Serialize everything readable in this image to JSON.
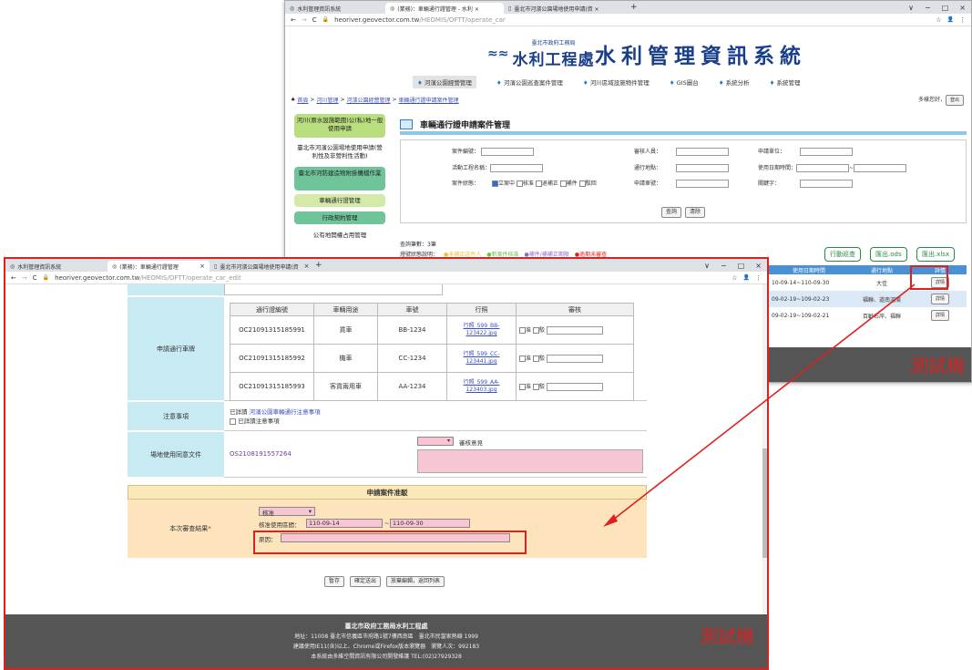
{
  "back_window": {
    "tabs": [
      {
        "label": "水利管理資訊系統"
      },
      {
        "label": "(業務)：車輛通行證管理 - 水利 ×"
      },
      {
        "label": "臺北市河濱公園場地使用申請(資 ×"
      }
    ],
    "new_tab": "+",
    "controls": {
      "min": "−",
      "max": "□",
      "close": "×",
      "chevron": "∨"
    },
    "nav": {
      "back": "←",
      "forward": "→",
      "reload": "C",
      "lock": "🔒"
    },
    "url_host": "heoriver.geovector.com.tw",
    "url_path": "/HEOMIS/OFTT/operate_car",
    "bar_icons": {
      "star": "☆",
      "profile": "👤",
      "menu": "⋮"
    },
    "banner": {
      "agency_small": "臺北市政府工務局",
      "agency": "水利工程處",
      "system_title": "水利管理資訊系統"
    },
    "topnav": [
      "河濱公園經營管理",
      "河濱公園巡查案件管理",
      "河川區域設施物件管理",
      "GIS圖台",
      "系統分析",
      "系統管理"
    ],
    "breadcrumb": [
      "首頁",
      "河川管理",
      "河濱公園經營管理",
      "車輛通行證申請案件管理"
    ],
    "breadcrumb_sep": ">",
    "home_icon": "♠",
    "greeting": "多樣您好，",
    "logout": "登出",
    "side_menu": [
      "河川(原水設施範圍)公(私)地一般使用申請",
      "臺北市河濱公園場地使用申請(營利性及非營利性活動)",
      "臺北市河防建造物附掛攤檔作業",
      "車輛通行證管理",
      "行政契約管理",
      "公有地開權占用管理"
    ],
    "page_title": "車輛通行證申請案件管理",
    "search_labels": [
      "案件編號：",
      "審核人員：",
      "申請單位：",
      "活動工程名稱：",
      "通行地點：",
      "使用日期時間：",
      "案件狀態：",
      "申請車號：",
      "關鍵字："
    ],
    "date_sep": "~",
    "status_options": [
      "立案中",
      "核准",
      "退補正",
      "補件",
      "駁回"
    ],
    "query_btn": "查詢",
    "clear_btn": "清除",
    "count_text": "查詢筆數：3筆",
    "legend_title": "燈號狀態說明：",
    "legend": [
      {
        "label": "未補正送件人",
        "color": "#f0c030"
      },
      {
        "label": "新案件核准",
        "color": "#6ac04a"
      },
      {
        "label": "補件/補補正期限",
        "color": "#8a6cc8"
      },
      {
        "label": "逾期未審查",
        "color": "#e02020"
      }
    ],
    "action_buttons": [
      "行動巡查",
      "匯出.ods",
      "匯出.xlsx"
    ],
    "table_headers": [
      "使用日期時間",
      "通行地點",
      "詳情"
    ],
    "rows": [
      {
        "date": "10-09-14~110-09-30",
        "place": "大佳",
        "btn": "詳情"
      },
      {
        "date": "09-02-19~109-02-23",
        "place": "福聯、道南河濱",
        "btn": "詳情"
      },
      {
        "date": "09-02-19~109-02-21",
        "place": "百齡右岸、福聯",
        "btn": "詳情"
      }
    ],
    "watermark": "測試機"
  },
  "front_window": {
    "tabs": [
      {
        "label": "水利管理資訊系統"
      },
      {
        "label": "(業務)：車輛通行證管理"
      },
      {
        "label": "臺北市河濱公園場地使用申請(資"
      }
    ],
    "new_tab": "+",
    "controls": {
      "min": "−",
      "max": "□",
      "close": "×",
      "chevron": "∨"
    },
    "nav": {
      "back": "←",
      "forward": "→",
      "reload": "C",
      "lock": "🔒"
    },
    "url_host": "heoriver.geovector.com.tw",
    "url_path": "/HEOMIS/OFTT/operate_car_edit",
    "bar_icons": {
      "star": "☆",
      "profile": "👤",
      "menu": "⋮"
    },
    "vehicle_section_label": "申請通行車牌",
    "vehicle_headers": [
      "通行證編號",
      "車輛用途",
      "車號",
      "行照",
      "審核"
    ],
    "vehicles": [
      {
        "permit": "OC21091315185991",
        "use": "貨車",
        "plate": "BB-1234",
        "file": "行照_599_BB-123422.jpg"
      },
      {
        "permit": "OC21091315185992",
        "use": "機車",
        "plate": "CC-1234",
        "file": "行照_599_CC-123441.jpg"
      },
      {
        "permit": "OC21091315185993",
        "use": "客貨兩用車",
        "plate": "AA-1234",
        "file": "行照_599_AA-123403.jpg"
      }
    ],
    "approve_opt": "准",
    "reject_opt": "駁",
    "notice_label": "注意事項",
    "notice_line1_prefix": "已詳讀",
    "notice_line1_link": "河濱公園車輛通行注意事項",
    "notice_line2": "已詳讀注意事項",
    "venue_label": "場地使用同意文件",
    "venue_value": "OS2108191557264",
    "review_opinion_label": "審核意見",
    "approval_header": "申請案件准駁",
    "result_label": "本次審查結果",
    "required_mark": "*",
    "result_select": "核准",
    "approved_period_label": "核准使用區間：",
    "period_start": "110-09-14",
    "period_sep": "~",
    "period_end": "110-09-30",
    "reason_label": "原因：",
    "buttons": [
      "暫存",
      "確定送出",
      "放棄編輯，返回列表"
    ],
    "footer": {
      "title": "臺北市政府工務局水利工程處",
      "address": "地址：11008 臺北市信義區市府路1號7樓西南區　臺北市民當家熱線 1999",
      "browser_note": "建議使用IE11(含)以上、Chrome或Firefox版本瀏覽器　瀏覽人次：992183",
      "maintainer": "本系統由多維空間資訊有限公司開發維護 TEL:(02)27929328"
    },
    "watermark": "測試機"
  },
  "colors": {
    "highlight_red": "#e0201e",
    "green_btn": "#2a8a44",
    "approval_bg": "#fde4bd",
    "label_bg": "#c8eaf2"
  }
}
